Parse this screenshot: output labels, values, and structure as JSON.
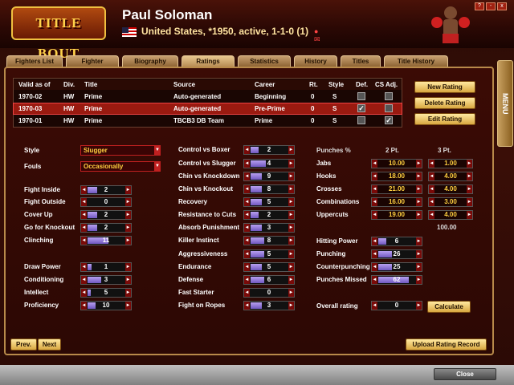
{
  "header": {
    "logo": "TITLE BOUT",
    "name": "Paul Soloman",
    "info": "United States, *1950, active, 1-1-0 (1)"
  },
  "window": {
    "buttons": [
      "?",
      "-",
      "x"
    ]
  },
  "menu_tab": "MENU",
  "tabs": [
    "Fighters List",
    "Fighter",
    "Biography",
    "Ratings",
    "Statistics",
    "History",
    "Titles",
    "Title History"
  ],
  "active_tab": "Ratings",
  "rating_table": {
    "columns": [
      "Valid as of",
      "Div.",
      "Title",
      "Source",
      "Career",
      "Rt.",
      "Style",
      "Def.",
      "CS Adj."
    ],
    "rows": [
      {
        "date": "1970-02",
        "div": "HW",
        "title": "Prime",
        "source": "Auto-generated",
        "career": "Beginning",
        "rt": "0",
        "style": "S",
        "def": false,
        "cs": false
      },
      {
        "date": "1970-03",
        "div": "HW",
        "title": "Prime",
        "source": "Auto-generated",
        "career": "Pre-Prime",
        "rt": "0",
        "style": "S",
        "def": true,
        "cs": false
      },
      {
        "date": "1970-01",
        "div": "HW",
        "title": "Prime",
        "source": "TBCB3 DB Team",
        "career": "Prime",
        "rt": "0",
        "style": "S",
        "def": false,
        "cs": true
      }
    ]
  },
  "actions": {
    "new": "New Rating",
    "delete": "Delete Rating",
    "edit": "Edit Rating"
  },
  "style_label": "Style",
  "style_value": "Slugger",
  "fouls_label": "Fouls",
  "fouls_value": "Occasionally",
  "col1": [
    {
      "label": "Fight Inside",
      "value": "2",
      "level": 0.25
    },
    {
      "label": "Fight Outside",
      "value": "0",
      "level": 0.0
    },
    {
      "label": "Cover Up",
      "value": "2",
      "level": 0.25
    },
    {
      "label": "Go for Knockout",
      "value": "2",
      "level": 0.25
    },
    {
      "label": "Clinching",
      "value": "11",
      "level": 0.55
    },
    {
      "label": "Draw Power",
      "value": "1",
      "level": 0.1
    },
    {
      "label": "Conditioning",
      "value": "3",
      "level": 0.35
    },
    {
      "label": "Intellect",
      "value": "5",
      "level": 0.08
    },
    {
      "label": "Proficiency",
      "value": "10",
      "level": 0.2
    }
  ],
  "col2": [
    {
      "label": "Control vs Boxer",
      "value": "2",
      "level": 0.2
    },
    {
      "label": "Control vs Slugger",
      "value": "4",
      "level": 0.4
    },
    {
      "label": "Chin vs Knockdown",
      "value": "9",
      "level": 0.3
    },
    {
      "label": "Chin vs Knockout",
      "value": "8",
      "level": 0.3
    },
    {
      "label": "Recovery",
      "value": "5",
      "level": 0.3
    },
    {
      "label": "Resistance to Cuts",
      "value": "2",
      "level": 0.2
    },
    {
      "label": "Absorb Punishment",
      "value": "3",
      "level": 0.3
    },
    {
      "label": "Killer Instinct",
      "value": "8",
      "level": 0.35
    },
    {
      "label": "Aggressiveness",
      "value": "5",
      "level": 0.35
    },
    {
      "label": "Endurance",
      "value": "5",
      "level": 0.3
    },
    {
      "label": "Defense",
      "value": "6",
      "level": 0.35
    },
    {
      "label": "Fast Starter",
      "value": "0",
      "level": 0.0
    },
    {
      "label": "Fight on Ropes",
      "value": "3",
      "level": 0.3
    }
  ],
  "punches": {
    "header": "Punches %",
    "pt2": "2 Pt.",
    "pt3": "3 Pt.",
    "rows": [
      {
        "label": "Jabs",
        "a": "10.00",
        "b": "1.00"
      },
      {
        "label": "Hooks",
        "a": "18.00",
        "b": "4.00"
      },
      {
        "label": "Crosses",
        "a": "21.00",
        "b": "4.00"
      },
      {
        "label": "Combinations",
        "a": "16.00",
        "b": "3.00"
      },
      {
        "label": "Uppercuts",
        "a": "19.00",
        "b": "4.00"
      }
    ],
    "total": "100.00"
  },
  "col3": [
    {
      "label": "Hitting Power",
      "value": "6",
      "level": 0.2
    },
    {
      "label": "Punching",
      "value": "26",
      "level": 0.35
    },
    {
      "label": "Counterpunching",
      "value": "25",
      "level": 0.35
    },
    {
      "label": "Punches Missed",
      "value": "62",
      "level": 0.8
    }
  ],
  "overall": {
    "label": "Overall rating",
    "value": "0",
    "button": "Calculate"
  },
  "nav": {
    "prev": "Prev.",
    "next": "Next",
    "upload": "Upload Rating Record"
  },
  "close": "Close"
}
